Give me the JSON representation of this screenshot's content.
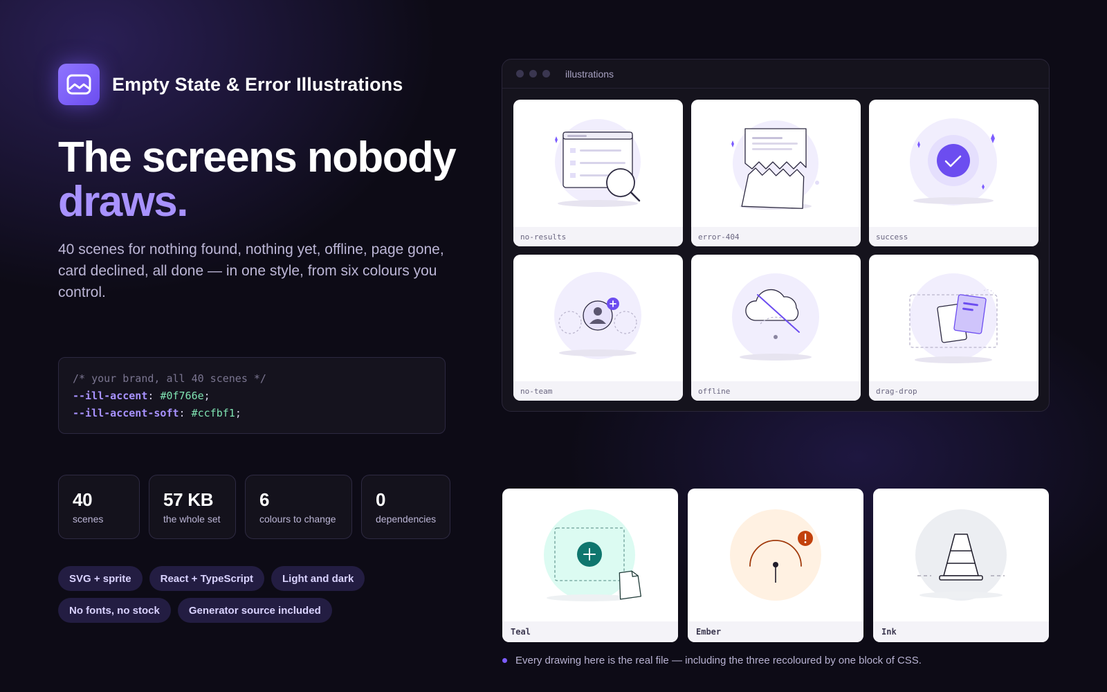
{
  "brand": {
    "name": "Empty State & Error Illustrations",
    "logo_icon": "image-frame-icon",
    "accent": "#7c5cff"
  },
  "hero": {
    "headline_line1": "The screens nobody",
    "headline_line2": "draws.",
    "lede": "40 scenes for nothing found, nothing yet, offline, page gone, card declined, all done — in one style, from six colours you control."
  },
  "code": {
    "comment": "/* your brand, all 40 scenes */",
    "lines": [
      {
        "prop": "--ill-accent",
        "value": "#0f766e"
      },
      {
        "prop": "--ill-accent-soft",
        "value": "#ccfbf1"
      }
    ]
  },
  "stats": [
    {
      "value": "40",
      "label": "scenes"
    },
    {
      "value": "57 KB",
      "label": "the whole set"
    },
    {
      "value": "6",
      "label": "colours to change"
    },
    {
      "value": "0",
      "label": "dependencies"
    }
  ],
  "chips": [
    "SVG + sprite",
    "React + TypeScript",
    "Light and dark",
    "No fonts, no stock",
    "Generator source included"
  ],
  "window": {
    "title": "illustrations",
    "cards": [
      {
        "label": "no-results",
        "icon": "search-magnifier-icon"
      },
      {
        "label": "error-404",
        "icon": "torn-page-icon"
      },
      {
        "label": "success",
        "icon": "check-circle-icon"
      },
      {
        "label": "no-team",
        "icon": "add-user-icon"
      },
      {
        "label": "offline",
        "icon": "cloud-offline-icon"
      },
      {
        "label": "drag-drop",
        "icon": "drag-files-icon"
      }
    ]
  },
  "themes": [
    {
      "label": "Teal",
      "color": "#0f766e",
      "soft": "#dcfbf2",
      "icon": "add-placeholder-icon"
    },
    {
      "label": "Ember",
      "color": "#c2410c",
      "soft": "#fff1e2",
      "icon": "gauge-alert-icon"
    },
    {
      "label": "Ink",
      "color": "#1f1d2b",
      "soft": "#eceef2",
      "icon": "traffic-cone-icon"
    }
  ],
  "footnote": "Every drawing here is the real file — including the three recoloured by one block of CSS."
}
